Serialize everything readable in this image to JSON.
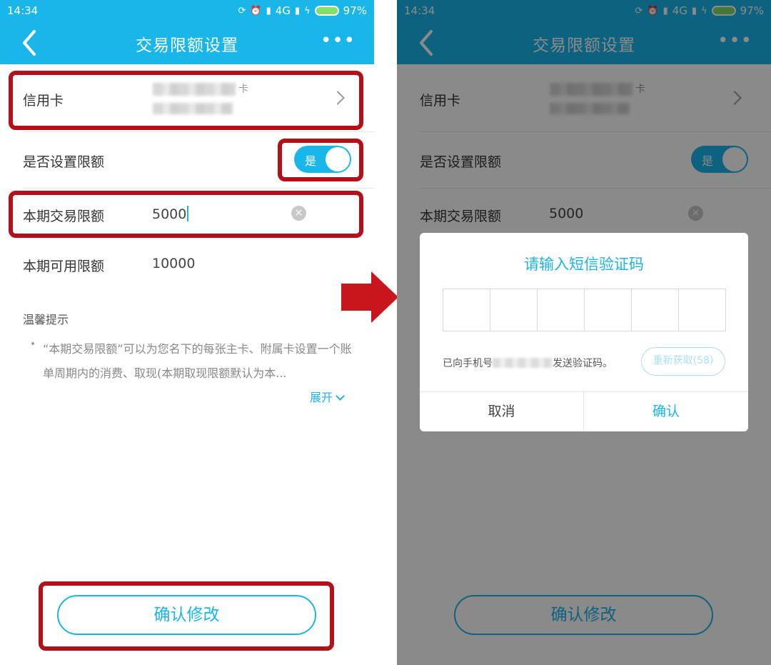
{
  "status_bar": {
    "time": "14:34",
    "network": "4G",
    "battery": "97%"
  },
  "nav": {
    "title": "交易限额设置",
    "more": "•••"
  },
  "form": {
    "card_label": "信用卡",
    "card_suffix": "卡",
    "limit_toggle_label": "是否设置限额",
    "toggle_text": "是",
    "period_limit_label": "本期交易限额",
    "period_limit_value": "5000",
    "available_label": "本期可用限额",
    "available_value": "10000"
  },
  "tips": {
    "title": "温馨提示",
    "bullet": "•",
    "text": "“本期交易限额”可以为您名下的每张主卡、附属卡设置一个账单周期内的消费、取现(本期取现限额默认为本...",
    "expand": "展开"
  },
  "confirm_button": "确认修改",
  "dialog": {
    "title": "请输入短信验证码",
    "code_length": 6,
    "sent_prefix": "已向手机号",
    "sent_suffix": "发送验证码。",
    "resend": "重新获取(58)",
    "cancel": "取消",
    "ok": "确认"
  },
  "colors": {
    "accent": "#19b6ea",
    "highlight": "#b3101a",
    "arrow": "#c9161c"
  }
}
